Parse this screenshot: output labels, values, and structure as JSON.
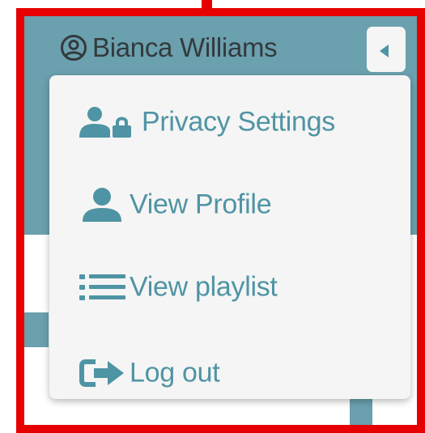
{
  "user": {
    "name": "Bianca Williams",
    "avatar_icon": "user-circle-icon"
  },
  "toggle": {
    "icon": "caret-left-icon"
  },
  "menu": {
    "items": [
      {
        "label": "Privacy Settings",
        "icon": "user-lock-icon"
      },
      {
        "label": "View Profile",
        "icon": "user-icon"
      },
      {
        "label": "View playlist",
        "icon": "list-icon"
      },
      {
        "label": "Log out",
        "icon": "sign-out-icon"
      }
    ]
  },
  "colors": {
    "accent": "#4f94a4",
    "header_bg": "#6ba0ae",
    "menu_bg": "#f5f5f5",
    "frame": "#e60000",
    "name_text": "#333a3d"
  }
}
